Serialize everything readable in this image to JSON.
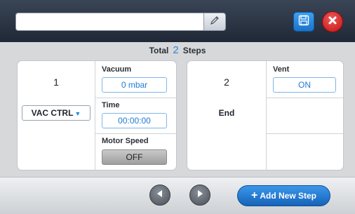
{
  "header": {
    "name_value": "",
    "name_placeholder": "",
    "icons": {
      "edit": "pencil-icon",
      "save": "floppy-disk-icon",
      "close": "close-x-icon"
    }
  },
  "summary": {
    "prefix": "Total",
    "count": "2",
    "suffix": "Steps"
  },
  "steps": [
    {
      "number": "1",
      "mode": "VAC CTRL",
      "vacuum_label": "Vacuum",
      "vacuum_value": "0  mbar",
      "time_label": "Time",
      "time_value": "00:00:00",
      "motor_label": "Motor Speed",
      "motor_value": "OFF"
    },
    {
      "number": "2",
      "type": "End",
      "vent_label": "Vent",
      "vent_value": "ON"
    }
  ],
  "footer": {
    "prev_icon": "triangle-left-icon",
    "next_icon": "triangle-right-icon",
    "add_label": "Add New Step"
  },
  "colors": {
    "accent": "#2a86dd",
    "danger": "#c11212",
    "topbar": "#263040"
  }
}
